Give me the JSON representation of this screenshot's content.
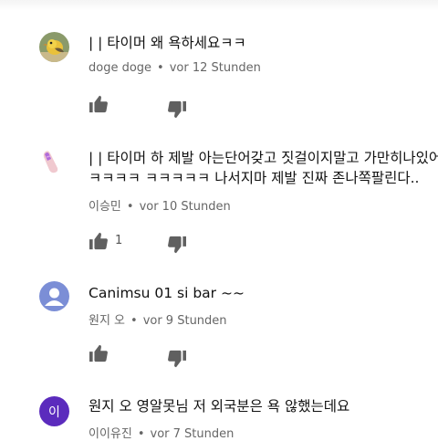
{
  "comments": [
    {
      "text_lines": [
        "| | 타이머 왜 욕하세요ㅋㅋ"
      ],
      "author": "doge doge",
      "time": "vor 12 Stunden",
      "likes": "",
      "avatar": "bird-avatar"
    },
    {
      "text_lines": [
        "| | 타이머 하 제발 아는단어갖고 짓걸이지말고 가만히나있어",
        "ㅋㅋㅋㅋ ㅋㅋㅋㅋㅋ 나서지마 제발 진짜 존나쪽팔린다.."
      ],
      "author": "이승민",
      "time": "vor 10 Stunden",
      "likes": "1",
      "avatar": "hand-avatar"
    },
    {
      "text_lines": [
        "Canimsu 01 si bar ~~"
      ],
      "author": "원지 오",
      "time": "vor 9 Stunden",
      "likes": "",
      "avatar": "default-person-avatar"
    },
    {
      "text_lines": [
        "원지 오 영알못님 저 외국분은 욕 않했는데요"
      ],
      "author": "이이유진",
      "time": "vor 7 Stunden",
      "likes": "",
      "avatar_letter": "이"
    }
  ],
  "separator": "•",
  "colors": {
    "letter_avatar_bg": "#5b2bbd",
    "default_avatar_bg": "#7b8ed6",
    "icon": "#606060"
  }
}
